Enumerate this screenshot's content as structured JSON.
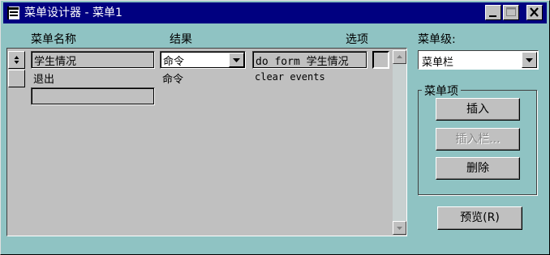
{
  "window": {
    "title": "菜单设计器 - 菜单1"
  },
  "columns": {
    "name": "菜单名称",
    "result": "结果",
    "options": "选项"
  },
  "rows": [
    {
      "name": "学生情况",
      "result": "命令",
      "command": "do form 学生情况"
    },
    {
      "name": "退出",
      "result": "命令",
      "command": "clear events"
    }
  ],
  "new_row": {
    "name": ""
  },
  "menu_level": {
    "label": "菜单级:",
    "value": "菜单栏"
  },
  "menu_item_group": {
    "label": "菜单项",
    "insert": "插入",
    "insert_bar": "插入栏...",
    "delete": "删除"
  },
  "preview": "预览(R)",
  "icons": {
    "minimize": "minimize-icon",
    "maximize": "maximize-icon",
    "close": "close-icon",
    "move": "move-handle-icon",
    "dropdown": "dropdown-arrow-icon",
    "scroll_up": "scroll-up-icon",
    "scroll_down": "scroll-down-icon"
  },
  "colors": {
    "titlebar": "#000080",
    "window_bg": "#8fc3c3",
    "control_bg": "#c0c0c0"
  }
}
